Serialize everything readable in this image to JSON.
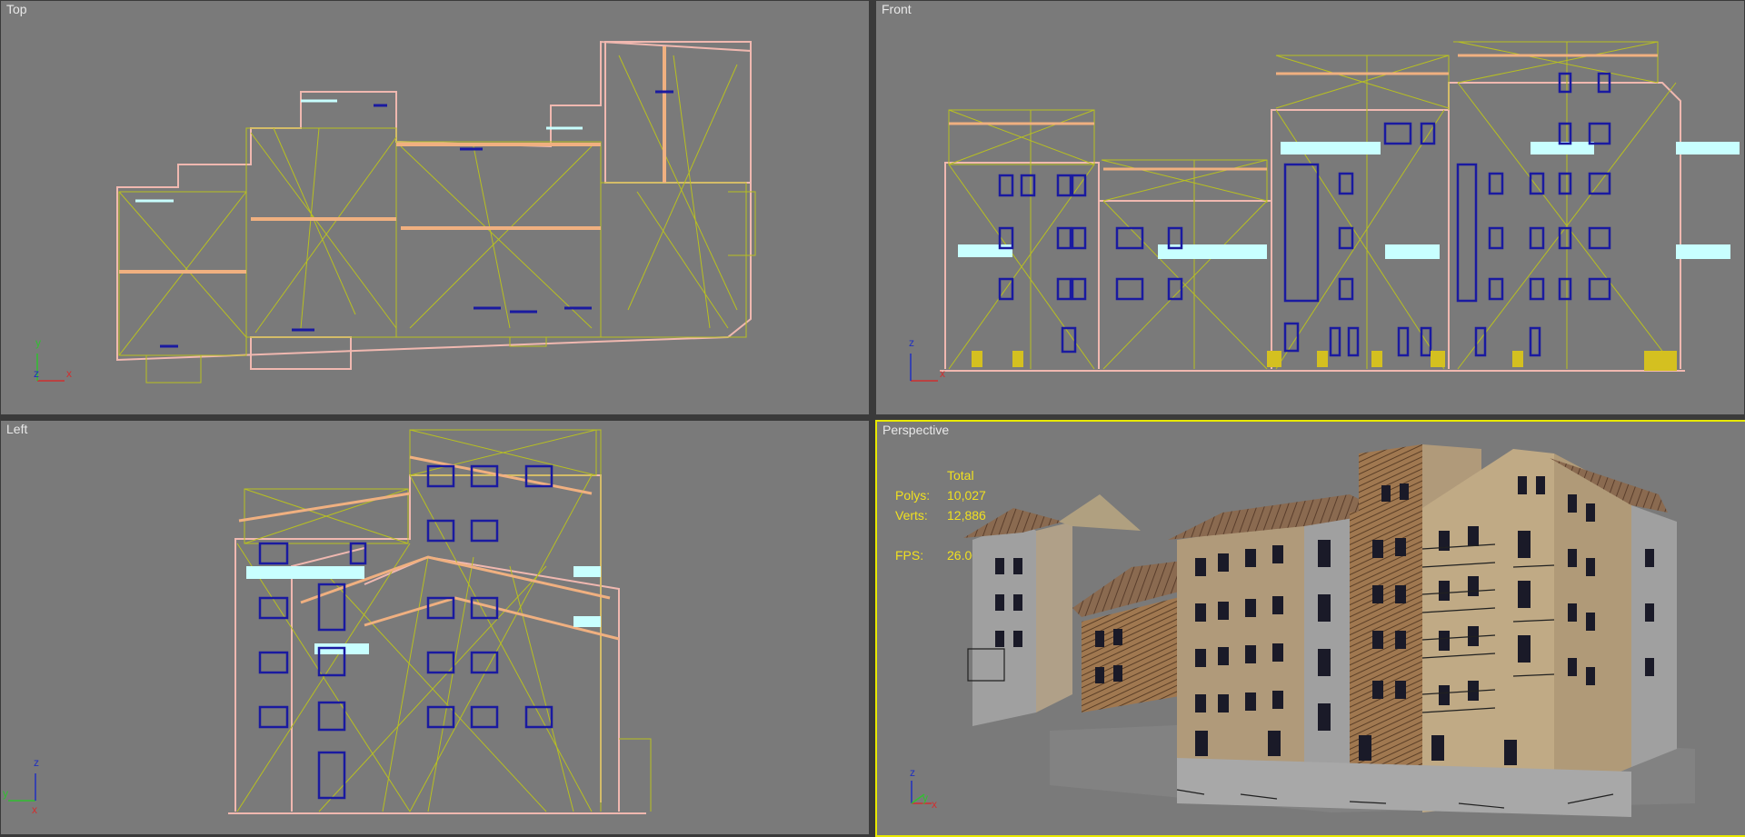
{
  "viewports": {
    "top": {
      "label": "Top"
    },
    "front": {
      "label": "Front"
    },
    "left": {
      "label": "Left"
    },
    "perspective": {
      "label": "Perspective"
    }
  },
  "stats": {
    "header": "Total",
    "polys_label": "Polys:",
    "polys_value": "10,027",
    "verts_label": "Verts:",
    "verts_value": "12,886",
    "fps_label": "FPS:",
    "fps_value": "26.004"
  },
  "axes": {
    "top": {
      "a": "y",
      "b": "z",
      "c": "x"
    },
    "front": {
      "a": "z",
      "c": "x"
    },
    "left": {
      "a": "z",
      "b": "y",
      "c": "x"
    },
    "perspective": {
      "a": "z",
      "b": "y",
      "c": "x"
    }
  },
  "colors": {
    "viewport_bg": "#7a7a7a",
    "active_border": "#e8e800",
    "wire_yellow": "#b8c020",
    "wire_pink": "#f0b8b0",
    "wire_orange": "#f0b080",
    "window_blue": "#1a1aa0",
    "glass_cyan": "#c8ffff",
    "stats_text": "#f0e020"
  }
}
